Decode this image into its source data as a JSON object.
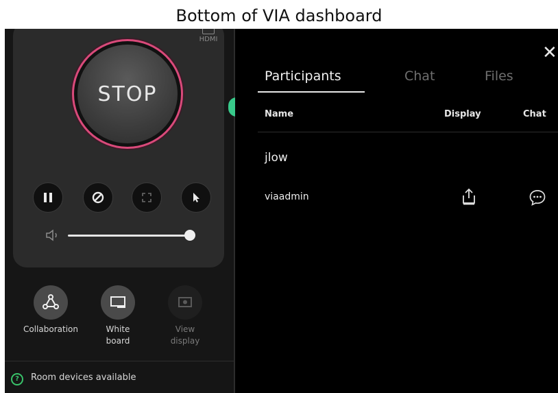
{
  "caption": "Bottom of VIA dashboard",
  "controls": {
    "hdmi_label": "HDMI",
    "stop_label": "STOP",
    "volume_level": 0.97
  },
  "tools": [
    {
      "label": "Collaboration",
      "icon": "collaboration-icon"
    },
    {
      "label": "White\nboard",
      "icon": "whiteboard-icon"
    },
    {
      "label": "View\ndisplay",
      "icon": "view-display-icon"
    }
  ],
  "status": {
    "text": "Room devices available"
  },
  "panel": {
    "tabs": [
      "Participants",
      "Chat",
      "Files"
    ],
    "active_tab": "Participants",
    "columns": [
      "Name",
      "Display",
      "Chat"
    ],
    "group_label": "jlow",
    "participants": [
      {
        "name": "viaadmin"
      }
    ]
  },
  "colors": {
    "ring": "#d94a7a",
    "accent": "#38c98a",
    "status_ok": "#39c36a"
  }
}
